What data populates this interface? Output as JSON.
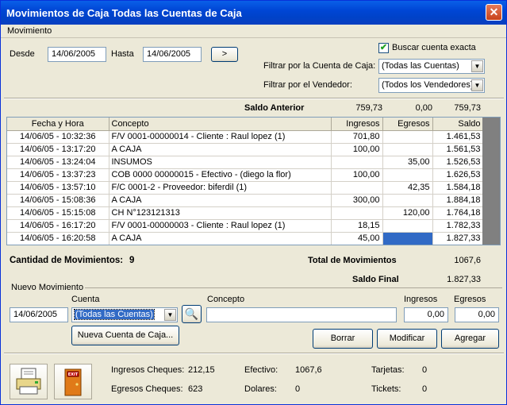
{
  "window": {
    "title": "Movimientos de Caja Todas las Cuentas de Caja"
  },
  "menu": {
    "movimiento": "Movimiento"
  },
  "filters": {
    "desde_label": "Desde",
    "desde_value": "14/06/2005",
    "hasta_label": "Hasta",
    "hasta_value": "14/06/2005",
    "go_label": ">",
    "buscar_exacta_label": "Buscar cuenta exacta",
    "buscar_exacta_checked": true,
    "cuenta_label": "Filtrar por la Cuenta de Caja:",
    "cuenta_value": "(Todas las Cuentas)",
    "vendedor_label": "Filtrar por el Vendedor:",
    "vendedor_value": "(Todos los Vendedores)"
  },
  "saldo_anterior": {
    "label": "Saldo Anterior",
    "ingresos": "759,73",
    "egresos": "0,00",
    "saldo": "759,73"
  },
  "table": {
    "headers": [
      "Fecha y Hora",
      "Concepto",
      "Ingresos",
      "Egresos",
      "Saldo"
    ],
    "rows": [
      [
        "14/06/05 - 10:32:36",
        "F/V 0001-00000014 - Cliente : Raul lopez (1)",
        "701,80",
        "",
        "1.461,53"
      ],
      [
        "14/06/05 - 13:17:20",
        "A CAJA",
        "100,00",
        "",
        "1.561,53"
      ],
      [
        "14/06/05 - 13:24:04",
        "INSUMOS",
        "",
        "35,00",
        "1.526,53"
      ],
      [
        "14/06/05 - 13:37:23",
        "COB  0000 00000015 - Efectivo - (diego la flor)",
        "100,00",
        "",
        "1.626,53"
      ],
      [
        "14/06/05 - 13:57:10",
        "F/C 0001-2 - Proveedor: biferdil (1)",
        "",
        "42,35",
        "1.584,18"
      ],
      [
        "14/06/05 - 15:08:36",
        "A CAJA",
        "300,00",
        "",
        "1.884,18"
      ],
      [
        "14/06/05 - 15:15:08",
        "CH N°123121313",
        "",
        "120,00",
        "1.764,18"
      ],
      [
        "14/06/05 - 16:17:20",
        "F/V 0001-00000003 - Cliente : Raul lopez (1)",
        "18,15",
        "",
        "1.782,33"
      ],
      [
        "14/06/05 - 16:20:58",
        "A CAJA",
        "45,00",
        "",
        "1.827,33"
      ]
    ]
  },
  "summary": {
    "cantidad_label": "Cantidad de Movimientos:",
    "cantidad_value": "9",
    "total_label": "Total de Movimientos",
    "total_value": "1067,6",
    "saldo_final_label": "Saldo Final",
    "saldo_final_value": "1.827,33"
  },
  "nuevo": {
    "group_label": "Nuevo Movimiento",
    "fecha_value": "14/06/2005",
    "cuenta_label": "Cuenta",
    "cuenta_value": "(Todas las Cuentas)",
    "concepto_label": "Concepto",
    "concepto_value": "",
    "ingresos_label": "Ingresos",
    "ingresos_value": "0,00",
    "egresos_label": "Egresos",
    "egresos_value": "0,00",
    "nueva_cuenta_btn": "Nueva Cuenta de Caja...",
    "borrar_btn": "Borrar",
    "modificar_btn": "Modificar",
    "agregar_btn": "Agregar"
  },
  "footer": {
    "exit_text": "EXIT",
    "ingresos_cheques_label": "Ingresos Cheques:",
    "ingresos_cheques_value": "212,15",
    "egresos_cheques_label": "Egresos Cheques:",
    "egresos_cheques_value": "623",
    "efectivo_label": "Efectivo:",
    "efectivo_value": "1067,6",
    "dolares_label": "Dolares:",
    "dolares_value": "0",
    "tarjetas_label": "Tarjetas:",
    "tarjetas_value": "0",
    "tickets_label": "Tickets:",
    "tickets_value": "0"
  }
}
